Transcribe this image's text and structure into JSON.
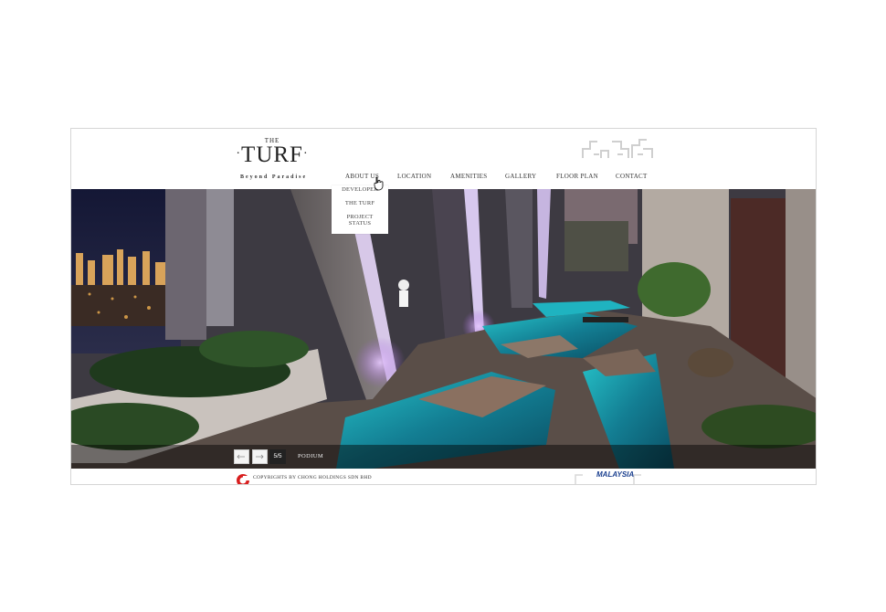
{
  "logo": {
    "the": "THE",
    "main": "TURF",
    "tagline": "Beyond Paradise"
  },
  "nav": [
    {
      "label": "ABOUT US"
    },
    {
      "label": "LOCATION"
    },
    {
      "label": "AMENITIES"
    },
    {
      "label": "GALLERY"
    },
    {
      "label": "FLOOR PLAN"
    },
    {
      "label": "CONTACT"
    }
  ],
  "dropdown": [
    {
      "label": "DEVELOPER"
    },
    {
      "label": "THE TURF"
    },
    {
      "label": "PROJECT"
    },
    {
      "label": "STATUS"
    }
  ],
  "slider": {
    "counter": "5/5",
    "label": "PODIUM",
    "prev_icon": "arrow-left-icon",
    "next_icon": "arrow-right-icon"
  },
  "footer": {
    "copyright": "COPYRIGHTS BY CHONG HOLDINGS SDN BHD",
    "malaysia": "MALAYSIA"
  },
  "colors": {
    "water": "#1aa0b0",
    "night_sky": "#1c1f3a",
    "accent_purple": "#b58ae0",
    "copyright_logo_red": "#d81e1e"
  }
}
